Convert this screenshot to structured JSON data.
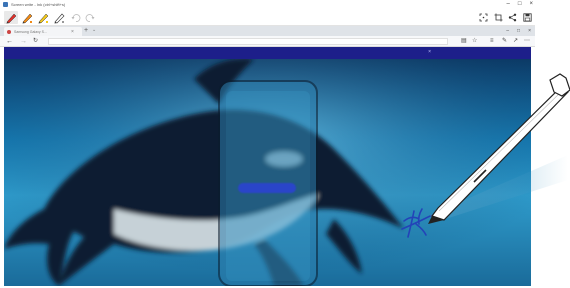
{
  "sw_window": {
    "title": "Screen write - Ink (ctrl+shift+s)"
  },
  "icons": {
    "app": "screen-write-app-icon",
    "pens": [
      "red-pen-icon",
      "orange-pen-icon",
      "yellow-pen-icon",
      "eraser-pen-icon"
    ],
    "undo": "undo-icon",
    "redo": "redo-icon",
    "crop": "crop-icon",
    "share": "share-icon",
    "save": "save-icon"
  },
  "colors": {
    "pen_red": "#e0312b",
    "pen_orange": "#f08a16",
    "pen_yellow": "#f2c81c",
    "banner": "#1d1f8a",
    "cta": "#2a45c9",
    "ink": "#2343b8"
  },
  "browser": {
    "tab_title": "Samsung Galaxy S..."
  }
}
